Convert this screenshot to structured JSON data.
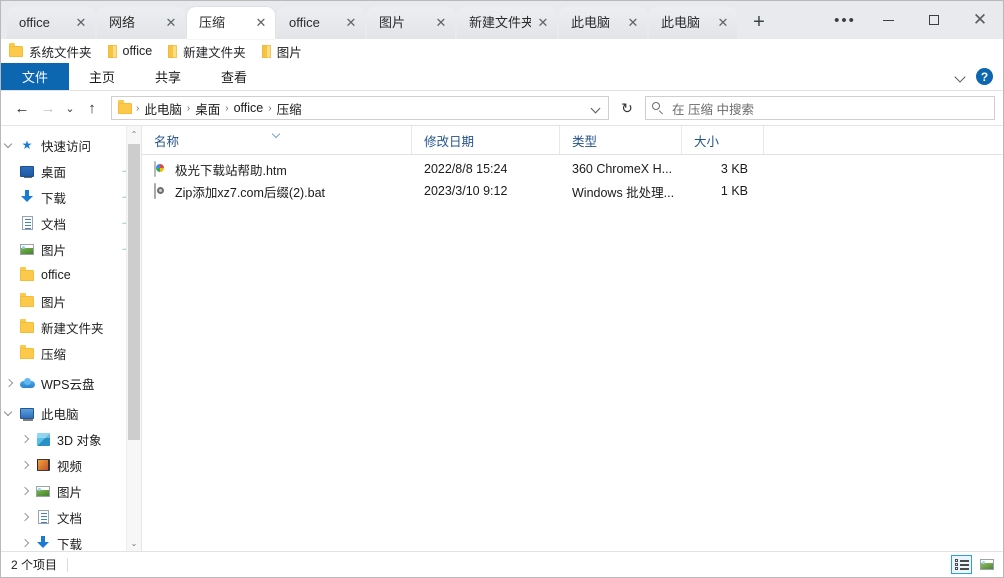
{
  "tabs": [
    {
      "label": "office",
      "active": false
    },
    {
      "label": "网络",
      "active": false
    },
    {
      "label": "压缩",
      "active": true
    },
    {
      "label": "office",
      "active": false
    },
    {
      "label": "图片",
      "active": false
    },
    {
      "label": "新建文件夹",
      "active": false
    },
    {
      "label": "此电脑",
      "active": false
    },
    {
      "label": "此电脑",
      "active": false
    }
  ],
  "tab_close_glyph": "✕",
  "newtab_glyph": "+",
  "window_controls": {
    "more": "•••",
    "minimize": "—",
    "maximize": "□",
    "close": "✕"
  },
  "bookmarks": [
    {
      "label": "系统文件夹",
      "icon": "folder-icon-open"
    },
    {
      "label": "office",
      "icon": "folder-icon"
    },
    {
      "label": "新建文件夹",
      "icon": "folder-icon"
    },
    {
      "label": "图片",
      "icon": "folder-icon"
    }
  ],
  "ribbon": {
    "tabs": [
      {
        "label": "文件",
        "active": true
      },
      {
        "label": "主页",
        "active": false
      },
      {
        "label": "共享",
        "active": false
      },
      {
        "label": "查看",
        "active": false
      }
    ],
    "expand_icon": "chevron-down-icon",
    "help_label": "?"
  },
  "addressbar": {
    "back_glyph": "←",
    "forward_glyph": "→",
    "history_glyph": "⌄",
    "up_glyph": "↑",
    "crumbs": [
      "此电脑",
      "桌面",
      "office",
      "压缩"
    ],
    "separator": "›",
    "refresh_glyph": "↻"
  },
  "search": {
    "placeholder": "在 压缩 中搜索"
  },
  "sidebar": {
    "items": [
      {
        "label": "快速访问",
        "icon": "star-pin-icon",
        "twisty": "down",
        "indent": 1,
        "pinned": false
      },
      {
        "label": "桌面",
        "icon": "desktop-icon",
        "twisty": "none",
        "indent": 2,
        "pinned": true
      },
      {
        "label": "下载",
        "icon": "download-icon",
        "twisty": "none",
        "indent": 2,
        "pinned": true
      },
      {
        "label": "文档",
        "icon": "document-icon",
        "twisty": "none",
        "indent": 2,
        "pinned": true
      },
      {
        "label": "图片",
        "icon": "pictures-icon",
        "twisty": "none",
        "indent": 2,
        "pinned": true
      },
      {
        "label": "office",
        "icon": "folder-icon",
        "twisty": "none",
        "indent": 2,
        "pinned": false
      },
      {
        "label": "图片",
        "icon": "folder-icon",
        "twisty": "none",
        "indent": 2,
        "pinned": false
      },
      {
        "label": "新建文件夹",
        "icon": "folder-icon",
        "twisty": "none",
        "indent": 2,
        "pinned": false
      },
      {
        "label": "压缩",
        "icon": "folder-icon",
        "twisty": "none",
        "indent": 2,
        "pinned": false
      },
      {
        "label": "WPS云盘",
        "icon": "cloud-icon",
        "twisty": "right",
        "indent": 1,
        "pinned": false
      },
      {
        "label": "此电脑",
        "icon": "this-pc-icon",
        "twisty": "down",
        "indent": 1,
        "pinned": false
      },
      {
        "label": "3D 对象",
        "icon": "3d-objects-icon",
        "twisty": "right",
        "indent": 2,
        "pinned": false
      },
      {
        "label": "视频",
        "icon": "videos-icon",
        "twisty": "right",
        "indent": 2,
        "pinned": false
      },
      {
        "label": "图片",
        "icon": "pictures-icon",
        "twisty": "right",
        "indent": 2,
        "pinned": false
      },
      {
        "label": "文档",
        "icon": "document-icon",
        "twisty": "right",
        "indent": 2,
        "pinned": false
      },
      {
        "label": "下载",
        "icon": "download-icon",
        "twisty": "right",
        "indent": 2,
        "pinned": false
      }
    ],
    "pin_glyph": "📌",
    "scroll_up_glyph": "⌃",
    "scroll_down_glyph": "⌄"
  },
  "filelist": {
    "columns": [
      {
        "label": "名称",
        "key": "name"
      },
      {
        "label": "修改日期",
        "key": "date"
      },
      {
        "label": "类型",
        "key": "type"
      },
      {
        "label": "大小",
        "key": "size"
      }
    ],
    "sort_icon": "sort-ascending-icon",
    "rows": [
      {
        "name": "极光下载站帮助.htm",
        "date": "2022/8/8 15:24",
        "type": "360 ChromeX H...",
        "size": "3 KB",
        "icon": "html-file-icon"
      },
      {
        "name": "Zip添加xz7.com后缀(2).bat",
        "date": "2023/3/10 9:12",
        "type": "Windows 批处理...",
        "size": "1 KB",
        "icon": "batch-file-icon"
      }
    ]
  },
  "statusbar": {
    "item_count": "2 个项目",
    "view_details_icon": "details-view-icon",
    "view_thumbnails_icon": "thumbnails-view-icon"
  },
  "colors": {
    "accent": "#0c66b0",
    "tabstrip_bg": "#e8eaed",
    "header_text": "#24548c",
    "folder_yellow": "#fcc94a",
    "view_active_border": "#2b9fe8"
  }
}
